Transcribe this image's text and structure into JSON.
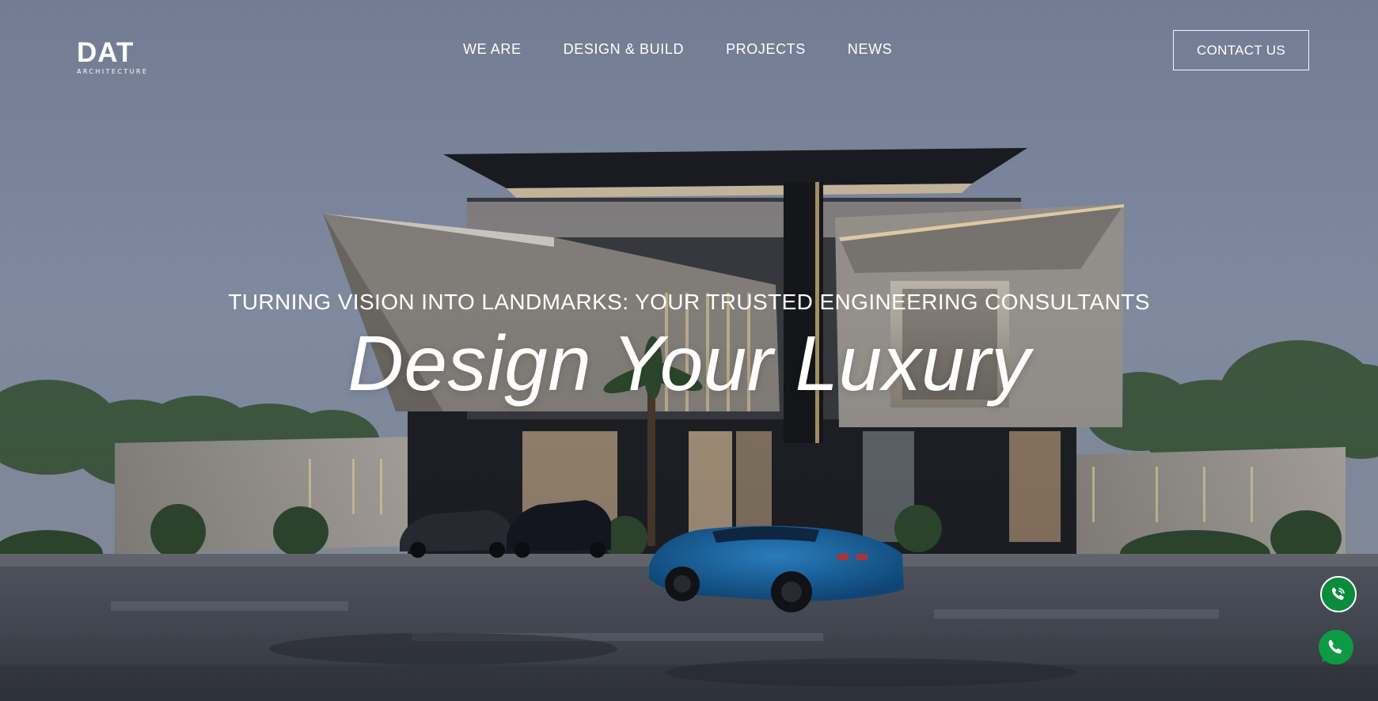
{
  "logo": {
    "mark": "DAT",
    "subtitle": "ARCHITECTURE"
  },
  "nav": {
    "items": [
      {
        "label": "WE ARE"
      },
      {
        "label": "DESIGN & BUILD"
      },
      {
        "label": "PROJECTS"
      },
      {
        "label": "NEWS"
      }
    ]
  },
  "header": {
    "contact_label": "CONTACT US"
  },
  "hero": {
    "tagline": "TURNING VISION INTO LANDMARKS: YOUR TRUSTED ENGINEERING CONSULTANTS",
    "headline": "Design Your Luxury",
    "image": "modern-villa-render"
  },
  "floating": {
    "call_icon": "phone-call-icon",
    "whatsapp_icon": "whatsapp-icon",
    "brand_green": "#0b8b3c"
  }
}
